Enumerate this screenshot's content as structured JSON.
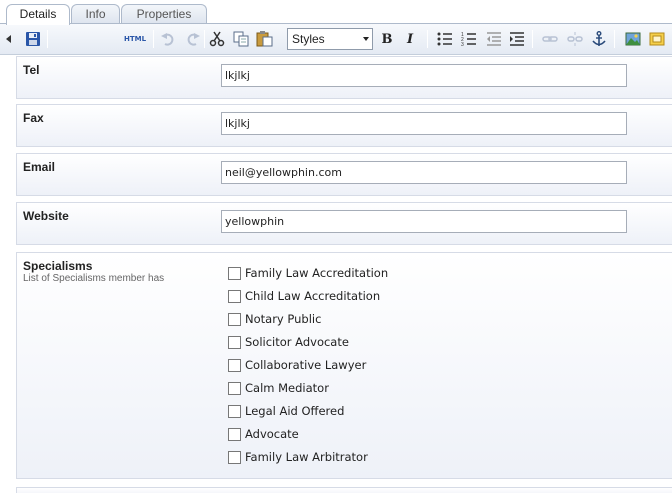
{
  "tabs": [
    {
      "label": "Details",
      "active": true
    },
    {
      "label": "Info",
      "active": false
    },
    {
      "label": "Properties",
      "active": false
    }
  ],
  "toolbar": {
    "html_label": "HTML",
    "styles_value": "Styles",
    "bold_label": "B",
    "italic_label": "I"
  },
  "fields": {
    "tel": {
      "label": "Tel",
      "value": "lkjlkj"
    },
    "fax": {
      "label": "Fax",
      "value": "lkjlkj"
    },
    "email": {
      "label": "Email",
      "value": "neil@yellowphin.com"
    },
    "website": {
      "label": "Website",
      "value": "yellowphin"
    }
  },
  "specialisms": {
    "label": "Specialisms",
    "description": "List of Specialisms member has",
    "options": [
      {
        "label": "Family Law Accreditation",
        "checked": false
      },
      {
        "label": "Child Law Accreditation",
        "checked": false
      },
      {
        "label": "Notary Public",
        "checked": false
      },
      {
        "label": "Solicitor Advocate",
        "checked": false
      },
      {
        "label": "Collaborative Lawyer",
        "checked": false
      },
      {
        "label": "Calm Mediator",
        "checked": false
      },
      {
        "label": "Legal Aid Offered",
        "checked": false
      },
      {
        "label": "Advocate",
        "checked": false
      },
      {
        "label": "Family Law Arbitrator",
        "checked": false
      }
    ]
  },
  "icons": [
    "collapse-arrow-icon",
    "save-icon",
    "html-icon",
    "undo-icon",
    "redo-icon",
    "cut-icon",
    "copy-icon",
    "paste-icon",
    "bold-icon",
    "italic-icon",
    "bullet-list-icon",
    "numbered-list-icon",
    "outdent-icon",
    "indent-icon",
    "link-icon",
    "unlink-icon",
    "anchor-icon",
    "insert-image-icon",
    "insert-media-icon"
  ]
}
